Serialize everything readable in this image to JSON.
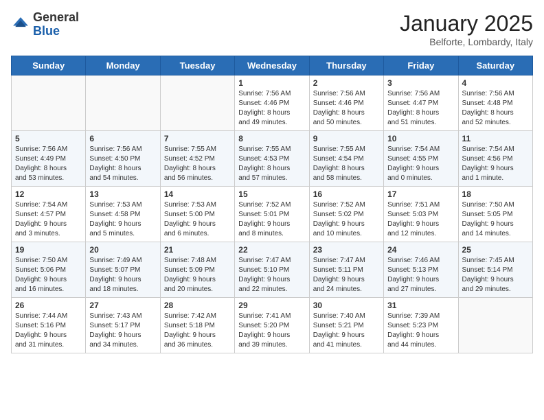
{
  "header": {
    "logo_general": "General",
    "logo_blue": "Blue",
    "title": "January 2025",
    "subtitle": "Belforte, Lombardy, Italy"
  },
  "days_of_week": [
    "Sunday",
    "Monday",
    "Tuesday",
    "Wednesday",
    "Thursday",
    "Friday",
    "Saturday"
  ],
  "weeks": [
    [
      {
        "day": "",
        "info": ""
      },
      {
        "day": "",
        "info": ""
      },
      {
        "day": "",
        "info": ""
      },
      {
        "day": "1",
        "info": "Sunrise: 7:56 AM\nSunset: 4:46 PM\nDaylight: 8 hours\nand 49 minutes."
      },
      {
        "day": "2",
        "info": "Sunrise: 7:56 AM\nSunset: 4:46 PM\nDaylight: 8 hours\nand 50 minutes."
      },
      {
        "day": "3",
        "info": "Sunrise: 7:56 AM\nSunset: 4:47 PM\nDaylight: 8 hours\nand 51 minutes."
      },
      {
        "day": "4",
        "info": "Sunrise: 7:56 AM\nSunset: 4:48 PM\nDaylight: 8 hours\nand 52 minutes."
      }
    ],
    [
      {
        "day": "5",
        "info": "Sunrise: 7:56 AM\nSunset: 4:49 PM\nDaylight: 8 hours\nand 53 minutes."
      },
      {
        "day": "6",
        "info": "Sunrise: 7:56 AM\nSunset: 4:50 PM\nDaylight: 8 hours\nand 54 minutes."
      },
      {
        "day": "7",
        "info": "Sunrise: 7:55 AM\nSunset: 4:52 PM\nDaylight: 8 hours\nand 56 minutes."
      },
      {
        "day": "8",
        "info": "Sunrise: 7:55 AM\nSunset: 4:53 PM\nDaylight: 8 hours\nand 57 minutes."
      },
      {
        "day": "9",
        "info": "Sunrise: 7:55 AM\nSunset: 4:54 PM\nDaylight: 8 hours\nand 58 minutes."
      },
      {
        "day": "10",
        "info": "Sunrise: 7:54 AM\nSunset: 4:55 PM\nDaylight: 9 hours\nand 0 minutes."
      },
      {
        "day": "11",
        "info": "Sunrise: 7:54 AM\nSunset: 4:56 PM\nDaylight: 9 hours\nand 1 minute."
      }
    ],
    [
      {
        "day": "12",
        "info": "Sunrise: 7:54 AM\nSunset: 4:57 PM\nDaylight: 9 hours\nand 3 minutes."
      },
      {
        "day": "13",
        "info": "Sunrise: 7:53 AM\nSunset: 4:58 PM\nDaylight: 9 hours\nand 5 minutes."
      },
      {
        "day": "14",
        "info": "Sunrise: 7:53 AM\nSunset: 5:00 PM\nDaylight: 9 hours\nand 6 minutes."
      },
      {
        "day": "15",
        "info": "Sunrise: 7:52 AM\nSunset: 5:01 PM\nDaylight: 9 hours\nand 8 minutes."
      },
      {
        "day": "16",
        "info": "Sunrise: 7:52 AM\nSunset: 5:02 PM\nDaylight: 9 hours\nand 10 minutes."
      },
      {
        "day": "17",
        "info": "Sunrise: 7:51 AM\nSunset: 5:03 PM\nDaylight: 9 hours\nand 12 minutes."
      },
      {
        "day": "18",
        "info": "Sunrise: 7:50 AM\nSunset: 5:05 PM\nDaylight: 9 hours\nand 14 minutes."
      }
    ],
    [
      {
        "day": "19",
        "info": "Sunrise: 7:50 AM\nSunset: 5:06 PM\nDaylight: 9 hours\nand 16 minutes."
      },
      {
        "day": "20",
        "info": "Sunrise: 7:49 AM\nSunset: 5:07 PM\nDaylight: 9 hours\nand 18 minutes."
      },
      {
        "day": "21",
        "info": "Sunrise: 7:48 AM\nSunset: 5:09 PM\nDaylight: 9 hours\nand 20 minutes."
      },
      {
        "day": "22",
        "info": "Sunrise: 7:47 AM\nSunset: 5:10 PM\nDaylight: 9 hours\nand 22 minutes."
      },
      {
        "day": "23",
        "info": "Sunrise: 7:47 AM\nSunset: 5:11 PM\nDaylight: 9 hours\nand 24 minutes."
      },
      {
        "day": "24",
        "info": "Sunrise: 7:46 AM\nSunset: 5:13 PM\nDaylight: 9 hours\nand 27 minutes."
      },
      {
        "day": "25",
        "info": "Sunrise: 7:45 AM\nSunset: 5:14 PM\nDaylight: 9 hours\nand 29 minutes."
      }
    ],
    [
      {
        "day": "26",
        "info": "Sunrise: 7:44 AM\nSunset: 5:16 PM\nDaylight: 9 hours\nand 31 minutes."
      },
      {
        "day": "27",
        "info": "Sunrise: 7:43 AM\nSunset: 5:17 PM\nDaylight: 9 hours\nand 34 minutes."
      },
      {
        "day": "28",
        "info": "Sunrise: 7:42 AM\nSunset: 5:18 PM\nDaylight: 9 hours\nand 36 minutes."
      },
      {
        "day": "29",
        "info": "Sunrise: 7:41 AM\nSunset: 5:20 PM\nDaylight: 9 hours\nand 39 minutes."
      },
      {
        "day": "30",
        "info": "Sunrise: 7:40 AM\nSunset: 5:21 PM\nDaylight: 9 hours\nand 41 minutes."
      },
      {
        "day": "31",
        "info": "Sunrise: 7:39 AM\nSunset: 5:23 PM\nDaylight: 9 hours\nand 44 minutes."
      },
      {
        "day": "",
        "info": ""
      }
    ]
  ]
}
